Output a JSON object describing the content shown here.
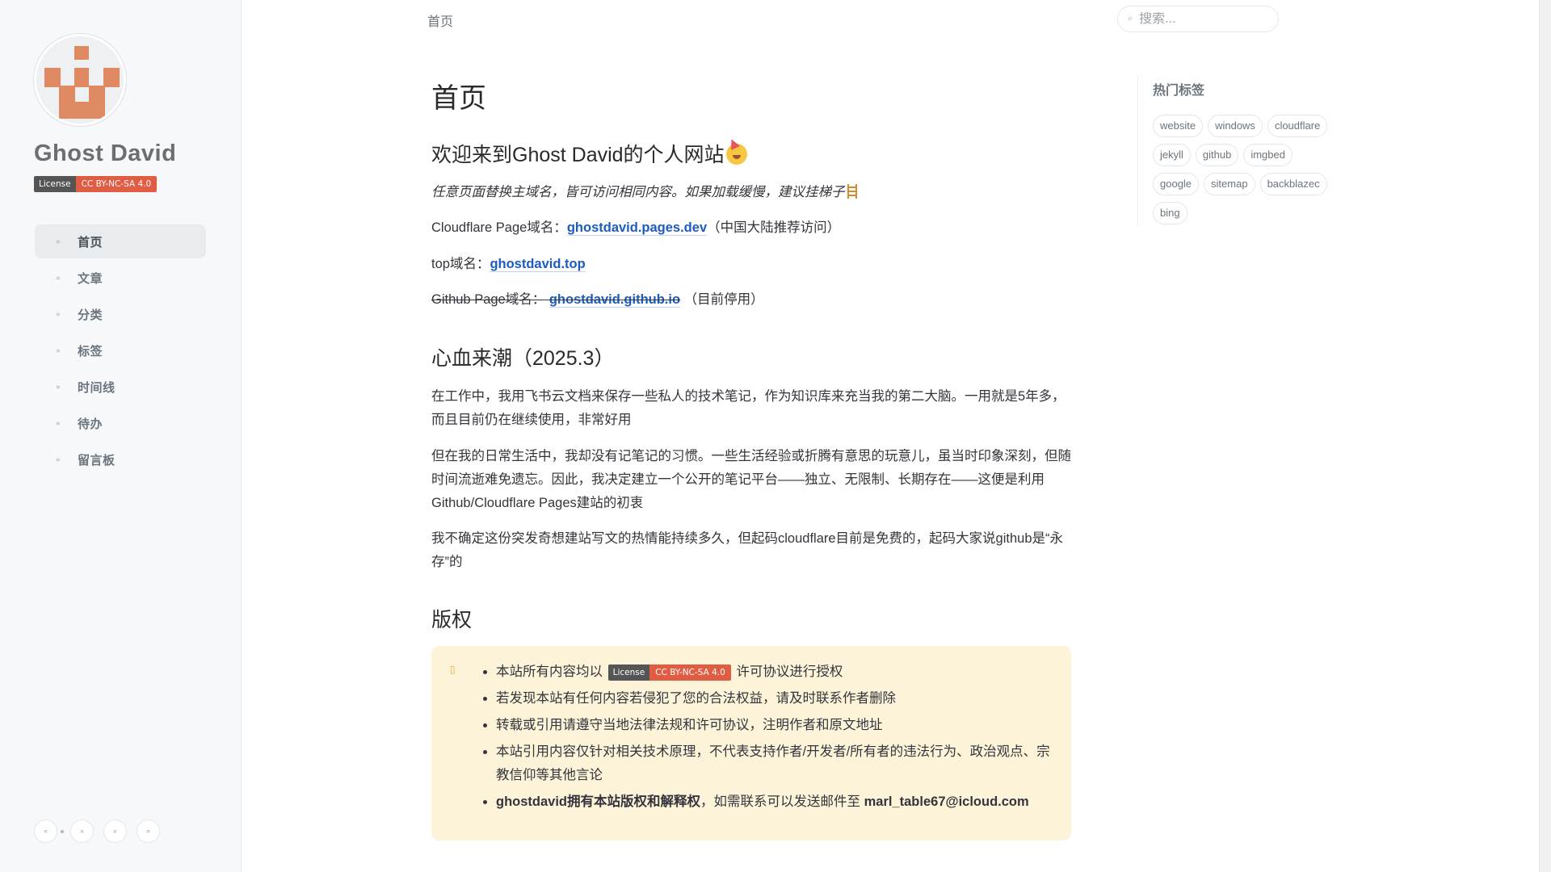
{
  "sidebar": {
    "title": "Ghost David",
    "license_badge": {
      "left": "License",
      "right": "CC BY-NC-SA 4.0"
    },
    "nav": [
      {
        "label": "首页",
        "icon": "home-icon",
        "active": true
      },
      {
        "label": "文章",
        "icon": "archive-icon"
      },
      {
        "label": "分类",
        "icon": "stream-icon"
      },
      {
        "label": "标签",
        "icon": "tag-icon"
      },
      {
        "label": "时间线",
        "icon": "timeline-icon"
      },
      {
        "label": "待办",
        "icon": "todo-icon"
      },
      {
        "label": "留言板",
        "icon": "comment-icon"
      }
    ],
    "bottom_buttons": [
      "theme-toggle-icon",
      "github-icon",
      "email-icon",
      "rss-icon"
    ]
  },
  "topbar": {
    "breadcrumb": "首页",
    "search_placeholder": "搜索..."
  },
  "main": {
    "page_title": "首页",
    "welcome_heading": "欢迎来到Ghost David的个人网站",
    "tip": "任意页面替换主域名，皆可访问相同内容。如果加载缓慢，建议挂梯子",
    "cf_prefix": "Cloudflare Page域名：",
    "cf_link": "ghostdavid.pages.dev",
    "cf_suffix": "（中国大陆推荐访问）",
    "top_prefix": "top域名：",
    "top_link": "ghostdavid.top",
    "gh_prefix": "Github Page域名：",
    "gh_link": "ghostdavid.github.io",
    "gh_suffix": "（目前停用）",
    "inspire_heading": "心血来潮（2025.3）",
    "para1": "在工作中，我用飞书云文档来保存一些私人的技术笔记，作为知识库来充当我的第二大脑。一用就是5年多，而且目前仍在继续使用，非常好用",
    "para2": "但在我的日常生活中，我却没有记笔记的习惯。一些生活经验或折腾有意思的玩意儿，虽当时印象深刻，但随时间流逝难免遗忘。因此，我决定建立一个公开的笔记平台——独立、无限制、长期存在——这便是利用Github/Cloudflare Pages建站的初衷",
    "para3": "我不确定这份突发奇想建站写文的热情能持续多久，但起码cloudflare目前是免费的，起码大家说github是“永存”的",
    "copyright_heading": "版权",
    "notice": {
      "item1_prefix": "本站所有内容均以",
      "item1_badge": {
        "left": "License",
        "right": "CC BY-NC-SA 4.0"
      },
      "item1_suffix": "许可协议进行授权",
      "item2": "若发现本站有任何内容若侵犯了您的合法权益，请及时联系作者删除",
      "item3": "转载或引用请遵守当地法律法规和许可协议，注明作者和原文地址",
      "item4": "本站引用内容仅针对相关技术原理，不代表支持作者/开发者/所有者的违法行为、政治观点、宗教信仰等其他言论",
      "item5_bold": "ghostdavid拥有本站版权和解释权",
      "item5_mid": "，如需联系可以发送邮件至 ",
      "item5_email": "marl_table67@icloud.com"
    }
  },
  "panel": {
    "title": "热门标签",
    "tags": [
      "website",
      "windows",
      "cloudflare",
      "jekyll",
      "github",
      "imgbed",
      "google",
      "sitemap",
      "backblazec",
      "bing"
    ]
  },
  "colors": {
    "accent_link": "#1c5bbf",
    "badge_right": "#e05d44",
    "notice_bg": "#fdf3d8",
    "avatar_block": "#e08a64"
  }
}
